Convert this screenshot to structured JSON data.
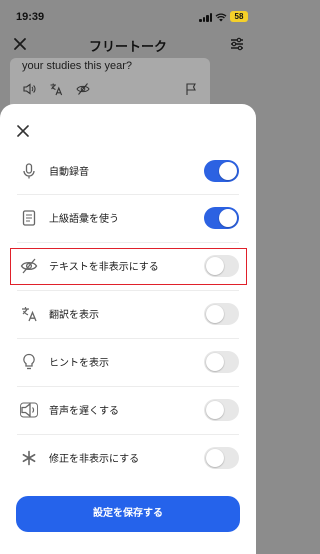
{
  "status_bar": {
    "time": "19:39",
    "battery": "58"
  },
  "header": {
    "title": "フリートーク"
  },
  "behind": {
    "message_text": "your studies this year?"
  },
  "settings": {
    "rows": [
      {
        "label": "自動録音",
        "icon": "microphone-icon",
        "on": true
      },
      {
        "label": "上級語彙を使う",
        "icon": "book-icon",
        "on": true
      },
      {
        "label": "テキストを非表示にする",
        "icon": "eye-off-icon",
        "on": false
      },
      {
        "label": "翻訳を表示",
        "icon": "translate-icon",
        "on": false
      },
      {
        "label": "ヒントを表示",
        "icon": "lightbulb-icon",
        "on": false
      },
      {
        "label": "音声を遅くする",
        "icon": "speaker-slow-icon",
        "on": false
      },
      {
        "label": "修正を非表示にする",
        "icon": "asterisk-icon",
        "on": false
      }
    ],
    "save_label": "設定を保存する"
  },
  "colors": {
    "accent": "#2563eb",
    "toggle_on": "#2c62e2",
    "highlight": "#e0202a"
  }
}
